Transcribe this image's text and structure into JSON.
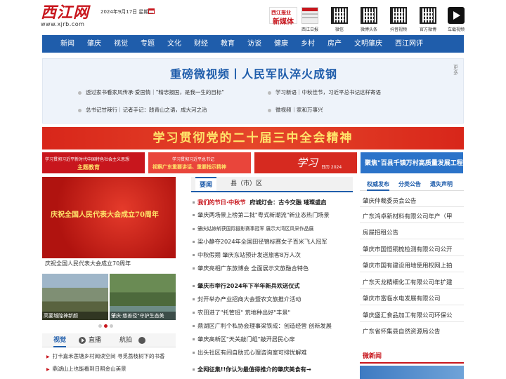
{
  "header": {
    "logo_title": "西江网",
    "logo_url": "www.xjrb.com",
    "date": "2024年9月17日 星期二",
    "qr_codes": [
      {
        "label": "西江日报",
        "kind": "paper"
      },
      {
        "label": "微信",
        "kind": "qr"
      },
      {
        "label": "微博头条",
        "kind": "qr"
      },
      {
        "label": "抖音视频",
        "kind": "qr"
      },
      {
        "label": "官方微博",
        "kind": "qr"
      },
      {
        "label": "车载视频",
        "kind": "play"
      }
    ],
    "badge_top": "西江报业",
    "badge_bottom": "新媒体"
  },
  "nav": [
    "新闻",
    "肇庆",
    "视觉",
    "专题",
    "文化",
    "财经",
    "教育",
    "访谈",
    "健康",
    "乡村",
    "房产",
    "文明肇庆",
    "西江网评"
  ],
  "headline": {
    "title": "重磅微视频丨人民军队淬火成钢",
    "more": "更多",
    "links": [
      "透过家书看家风传承·爱国情｜\"精忠报国，是我一生的目标\"",
      "学习新语｜中秋佳节，习近平总书记这样寄语",
      "总书记甘辣行｜记者手记：践青山之语，成大河之治",
      "微视频｜家和万事兴"
    ]
  },
  "banner": "学习贯彻党的二十届三中全会精神",
  "promos": [
    {
      "line1": "学习贯彻习近平新时代中国特色社会主义思想",
      "line2": "主题教育"
    },
    {
      "line1": "学习贯彻习近平总书记",
      "line2": "视察广东重要讲话、重要指示精神"
    },
    {
      "line1": "学习",
      "line2": "日历 2024"
    },
    {
      "line1": "聚焦\"百县千镇万村高质量发展工程\""
    }
  ],
  "hero": {
    "text": "庆祝全国人民代表大会成立70周年",
    "caption": "庆祝全国人民代表大会成立70周年"
  },
  "thumbs": [
    {
      "caption": "高要城隍神新颜"
    },
    {
      "caption": "肇庆·慈善径\"守护生态美"
    }
  ],
  "video_tabs": [
    "视觉",
    "直播",
    "航拍"
  ],
  "video_list": [
    "打卡嘉禾莲塘乡村阅读空间 寻觅荔枝树下的书香",
    "鼎湖山上也能看到日照金山美景"
  ],
  "middle_tabs": [
    "要闻",
    "县（市）区"
  ],
  "news": [
    {
      "tag": "我们的节日·中秋节",
      "text": "府城灯会：古今交融 璀璨盛启",
      "style": "bold"
    },
    {
      "text": "肇庆两场景上榜第二批\"粤式新潮流\"新业态热门场景",
      "style": ""
    },
    {
      "text": "肇庆姑娘斩获国际摄影赛事冠军 展示大湾区风采作品展",
      "style": "small"
    },
    {
      "text": "梁小静夺2024年全国田径锦标赛女子百米飞人冠军",
      "style": ""
    },
    {
      "text": "中秋假期 肇庆东站预计发送旅客8万人次",
      "style": ""
    },
    {
      "text": "肇庆亮相广东旅博会 全面展示文旅融合特色",
      "style": ""
    },
    {
      "text": "肇庆市举行2024年下半年新兵欢送仪式",
      "style": "bold"
    },
    {
      "text": "封开举办产业招商大会暨农文旅推介活动",
      "style": ""
    },
    {
      "text": "农田进了\"托管班\" 荒地种出好\"丰景\"",
      "style": ""
    },
    {
      "text": "鼎湖区广利个私协会理事梁铁成：创造经营 创新发展",
      "style": ""
    },
    {
      "text": "肇庆高新区\"天关敲门组\"敲开居民心扉",
      "style": ""
    },
    {
      "text": "出头社区有间自助式心理咨询室可排忧解难",
      "style": ""
    },
    {
      "text": "全网征集!!你认为最值得推介的肇庆美食有→",
      "style": "bold"
    }
  ],
  "right_tabs": [
    "权威发布",
    "分类公告",
    "遗失声明"
  ],
  "announcements": [
    "肇庆仲裁委员会公告",
    "广东鸿卓新材料有限公司年产（甲",
    "房屋招租公告",
    "肇庆市国恒铜梳检测有限公司公开",
    "肇庆市国有建设用地使用权网上拍",
    "广东天龙精细化工有限公司年扩建",
    "肇庆市富临水电发展有限公司",
    "肇庆盛汇食品加工有限公司环保公",
    "广东省怀集县自然资源局公告"
  ],
  "weixin_title": "微新闻",
  "colors": {
    "brand_red": "#c8161d",
    "nav_blue": "#1f5dab"
  }
}
